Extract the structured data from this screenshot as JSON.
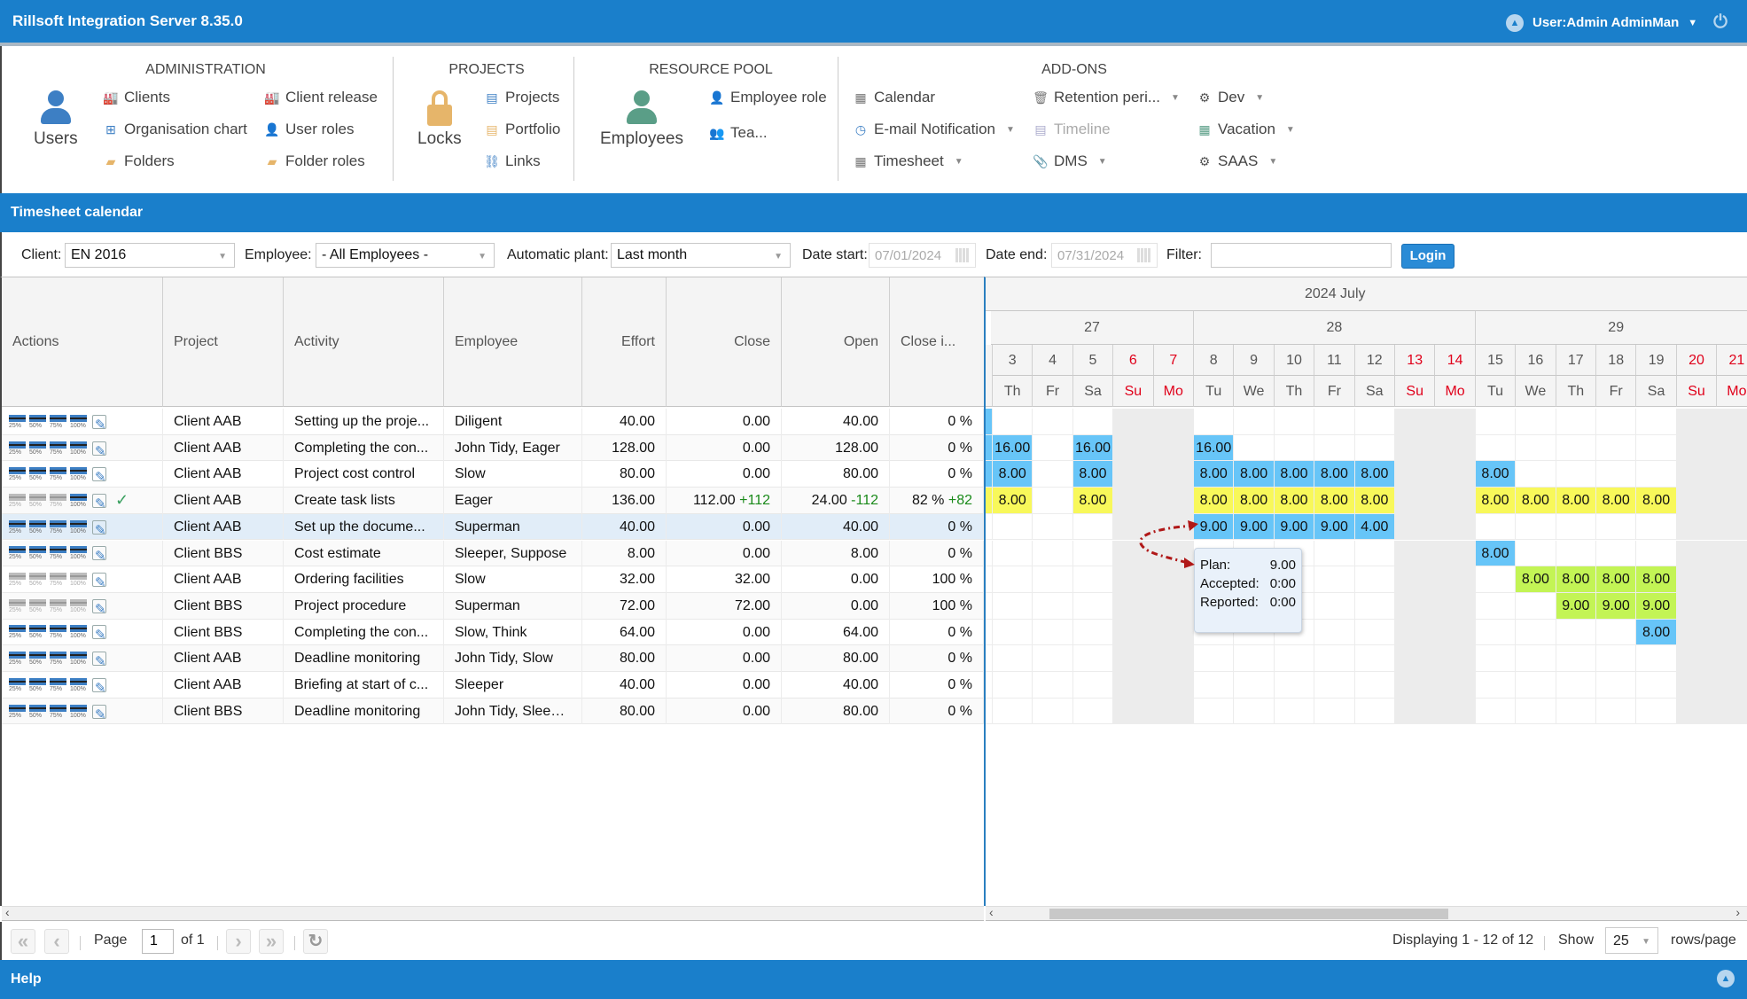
{
  "header": {
    "app_title": "Rillsoft Integration Server 8.35.0",
    "user_label": "User:Admin AdminMan"
  },
  "ribbon": {
    "groups": {
      "administration": "ADMINISTRATION",
      "projects": "PROJECTS",
      "resource_pool": "RESOURCE POOL",
      "addons": "ADD-ONS"
    },
    "users": "Users",
    "clients": "Clients",
    "org_chart": "Organisation chart",
    "folders": "Folders",
    "client_release": "Client release",
    "user_roles": "User roles",
    "folder_roles": "Folder roles",
    "locks": "Locks",
    "projects": "Projects",
    "portfolio": "Portfolio",
    "links": "Links",
    "employees": "Employees",
    "employee_role": "Employee role",
    "teams": "Tea...",
    "calendar": "Calendar",
    "email_notification": "E-mail Notification",
    "timesheet": "Timesheet",
    "retention": "Retention peri...",
    "timeline": "Timeline",
    "dms": "DMS",
    "dev": "Dev",
    "vacation": "Vacation",
    "saas": "SAAS"
  },
  "section_title": "Timesheet calendar",
  "filters": {
    "client_label": "Client:",
    "client_value": "EN 2016",
    "employee_label": "Employee:",
    "employee_value": "- All Employees -",
    "plant_label": "Automatic plant:",
    "plant_value": "Last month",
    "date_start_label": "Date start:",
    "date_start_value": "07/01/2024",
    "date_end_label": "Date end:",
    "date_end_value": "07/31/2024",
    "filter_label": "Filter:",
    "filter_value": "",
    "login_button": "Login"
  },
  "table": {
    "columns": [
      "Actions",
      "Project",
      "Activity",
      "Employee",
      "Effort",
      "Close",
      "Open",
      "Close i..."
    ],
    "rows": [
      {
        "project": "Client AAB",
        "activity": "Setting up the proje...",
        "employee": "Diligent",
        "effort": "40.00",
        "close": "0.00",
        "close_delta": "",
        "open": "40.00",
        "open_delta": "",
        "close_pct": "0 %",
        "pct_delta": "",
        "grey": [
          false,
          false,
          false,
          false
        ],
        "check": false
      },
      {
        "project": "Client AAB",
        "activity": "Completing the con...",
        "employee": "John Tidy, Eager",
        "effort": "128.00",
        "close": "0.00",
        "close_delta": "",
        "open": "128.00",
        "open_delta": "",
        "close_pct": "0 %",
        "pct_delta": "",
        "grey": [
          false,
          false,
          false,
          false
        ],
        "check": false
      },
      {
        "project": "Client AAB",
        "activity": "Project cost control",
        "employee": "Slow",
        "effort": "80.00",
        "close": "0.00",
        "close_delta": "",
        "open": "80.00",
        "open_delta": "",
        "close_pct": "0 %",
        "pct_delta": "",
        "grey": [
          false,
          false,
          false,
          false
        ],
        "check": false
      },
      {
        "project": "Client AAB",
        "activity": "Create task lists",
        "employee": "Eager",
        "effort": "136.00",
        "close": "112.00",
        "close_delta": "+112",
        "open": "24.00",
        "open_delta": "-112",
        "close_pct": "82 %",
        "pct_delta": "+82",
        "grey": [
          true,
          true,
          true,
          false
        ],
        "check": true
      },
      {
        "project": "Client AAB",
        "activity": "Set up the docume...",
        "employee": "Superman",
        "effort": "40.00",
        "close": "0.00",
        "close_delta": "",
        "open": "40.00",
        "open_delta": "",
        "close_pct": "0 %",
        "pct_delta": "",
        "grey": [
          false,
          false,
          false,
          false
        ],
        "check": false,
        "selected": true
      },
      {
        "project": "Client BBS",
        "activity": "Cost estimate",
        "employee": "Sleeper, Suppose",
        "effort": "8.00",
        "close": "0.00",
        "close_delta": "",
        "open": "8.00",
        "open_delta": "",
        "close_pct": "0 %",
        "pct_delta": "",
        "grey": [
          false,
          false,
          false,
          false
        ],
        "check": false
      },
      {
        "project": "Client AAB",
        "activity": "Ordering facilities",
        "employee": "Slow",
        "effort": "32.00",
        "close": "32.00",
        "close_delta": "",
        "open": "0.00",
        "open_delta": "",
        "close_pct": "100 %",
        "pct_delta": "",
        "grey": [
          true,
          true,
          true,
          true
        ],
        "check": false
      },
      {
        "project": "Client BBS",
        "activity": "Project procedure",
        "employee": "Superman",
        "effort": "72.00",
        "close": "72.00",
        "close_delta": "",
        "open": "0.00",
        "open_delta": "",
        "close_pct": "100 %",
        "pct_delta": "",
        "grey": [
          true,
          true,
          true,
          true
        ],
        "check": false
      },
      {
        "project": "Client BBS",
        "activity": "Completing the con...",
        "employee": "Slow, Think",
        "effort": "64.00",
        "close": "0.00",
        "close_delta": "",
        "open": "64.00",
        "open_delta": "",
        "close_pct": "0 %",
        "pct_delta": "",
        "grey": [
          false,
          false,
          false,
          false
        ],
        "check": false
      },
      {
        "project": "Client AAB",
        "activity": "Deadline monitoring",
        "employee": "John Tidy, Slow",
        "effort": "80.00",
        "close": "0.00",
        "close_delta": "",
        "open": "80.00",
        "open_delta": "",
        "close_pct": "0 %",
        "pct_delta": "",
        "grey": [
          false,
          false,
          false,
          false
        ],
        "check": false
      },
      {
        "project": "Client AAB",
        "activity": "Briefing at start of c...",
        "employee": "Sleeper",
        "effort": "40.00",
        "close": "0.00",
        "close_delta": "",
        "open": "40.00",
        "open_delta": "",
        "close_pct": "0 %",
        "pct_delta": "",
        "grey": [
          false,
          false,
          false,
          false
        ],
        "check": false
      },
      {
        "project": "Client BBS",
        "activity": "Deadline monitoring",
        "employee": "John Tidy, Sleeper",
        "effort": "80.00",
        "close": "0.00",
        "close_delta": "",
        "open": "80.00",
        "open_delta": "",
        "close_pct": "0 %",
        "pct_delta": "",
        "grey": [
          false,
          false,
          false,
          false
        ],
        "check": false
      }
    ],
    "pct_labels": [
      "25%",
      "50%",
      "75%",
      "100%"
    ]
  },
  "calendar": {
    "month": "2024 July",
    "weeks": [
      {
        "label": "27",
        "days": 5
      },
      {
        "label": "28",
        "days": 7
      },
      {
        "label": "29",
        "days": 7
      }
    ],
    "days": [
      {
        "num": "3",
        "wd": "Th",
        "weekend": false
      },
      {
        "num": "4",
        "wd": "Fr",
        "weekend": false
      },
      {
        "num": "5",
        "wd": "Sa",
        "weekend": false
      },
      {
        "num": "6",
        "wd": "Su",
        "weekend": true
      },
      {
        "num": "7",
        "wd": "Mo",
        "weekend": true
      },
      {
        "num": "8",
        "wd": "Tu",
        "weekend": false
      },
      {
        "num": "9",
        "wd": "We",
        "weekend": false
      },
      {
        "num": "10",
        "wd": "Th",
        "weekend": false
      },
      {
        "num": "11",
        "wd": "Fr",
        "weekend": false
      },
      {
        "num": "12",
        "wd": "Sa",
        "weekend": false
      },
      {
        "num": "13",
        "wd": "Su",
        "weekend": true
      },
      {
        "num": "14",
        "wd": "Mo",
        "weekend": true
      },
      {
        "num": "15",
        "wd": "Tu",
        "weekend": false
      },
      {
        "num": "16",
        "wd": "We",
        "weekend": false
      },
      {
        "num": "17",
        "wd": "Th",
        "weekend": false
      },
      {
        "num": "18",
        "wd": "Fr",
        "weekend": false
      },
      {
        "num": "19",
        "wd": "Sa",
        "weekend": false
      },
      {
        "num": "20",
        "wd": "Su",
        "weekend": true
      },
      {
        "num": "21",
        "wd": "Mo",
        "weekend": true
      }
    ],
    "entries": [
      {
        "row": 1,
        "day": "3",
        "value": "16.00",
        "color": "blue"
      },
      {
        "row": 1,
        "day": "5",
        "value": "16.00",
        "color": "blue"
      },
      {
        "row": 1,
        "day": "8",
        "value": "16.00",
        "color": "blue"
      },
      {
        "row": 2,
        "day": "3",
        "value": "8.00",
        "color": "blue"
      },
      {
        "row": 2,
        "day": "5",
        "value": "8.00",
        "color": "blue"
      },
      {
        "row": 2,
        "day": "8",
        "value": "8.00",
        "color": "blue"
      },
      {
        "row": 2,
        "day": "9",
        "value": "8.00",
        "color": "blue"
      },
      {
        "row": 2,
        "day": "10",
        "value": "8.00",
        "color": "blue"
      },
      {
        "row": 2,
        "day": "11",
        "value": "8.00",
        "color": "blue"
      },
      {
        "row": 2,
        "day": "12",
        "value": "8.00",
        "color": "blue"
      },
      {
        "row": 2,
        "day": "15",
        "value": "8.00",
        "color": "blue"
      },
      {
        "row": 3,
        "day": "3",
        "value": "8.00",
        "color": "yellow"
      },
      {
        "row": 3,
        "day": "5",
        "value": "8.00",
        "color": "yellow"
      },
      {
        "row": 3,
        "day": "8",
        "value": "8.00",
        "color": "yellow"
      },
      {
        "row": 3,
        "day": "9",
        "value": "8.00",
        "color": "yellow"
      },
      {
        "row": 3,
        "day": "10",
        "value": "8.00",
        "color": "yellow"
      },
      {
        "row": 3,
        "day": "11",
        "value": "8.00",
        "color": "yellow"
      },
      {
        "row": 3,
        "day": "12",
        "value": "8.00",
        "color": "yellow"
      },
      {
        "row": 3,
        "day": "15",
        "value": "8.00",
        "color": "yellow"
      },
      {
        "row": 3,
        "day": "16",
        "value": "8.00",
        "color": "yellow"
      },
      {
        "row": 3,
        "day": "17",
        "value": "8.00",
        "color": "yellow"
      },
      {
        "row": 3,
        "day": "18",
        "value": "8.00",
        "color": "yellow"
      },
      {
        "row": 3,
        "day": "19",
        "value": "8.00",
        "color": "yellow"
      },
      {
        "row": 4,
        "day": "8",
        "value": "9.00",
        "color": "blue"
      },
      {
        "row": 4,
        "day": "9",
        "value": "9.00",
        "color": "blue"
      },
      {
        "row": 4,
        "day": "10",
        "value": "9.00",
        "color": "blue"
      },
      {
        "row": 4,
        "day": "11",
        "value": "9.00",
        "color": "blue"
      },
      {
        "row": 4,
        "day": "12",
        "value": "4.00",
        "color": "blue"
      },
      {
        "row": 5,
        "day": "15",
        "value": "8.00",
        "color": "blue"
      },
      {
        "row": 6,
        "day": "16",
        "value": "8.00",
        "color": "green"
      },
      {
        "row": 6,
        "day": "17",
        "value": "8.00",
        "color": "green"
      },
      {
        "row": 6,
        "day": "18",
        "value": "8.00",
        "color": "green"
      },
      {
        "row": 6,
        "day": "19",
        "value": "8.00",
        "color": "green"
      },
      {
        "row": 7,
        "day": "17",
        "value": "9.00",
        "color": "green"
      },
      {
        "row": 7,
        "day": "18",
        "value": "9.00",
        "color": "green"
      },
      {
        "row": 7,
        "day": "19",
        "value": "9.00",
        "color": "green"
      },
      {
        "row": 8,
        "day": "19",
        "value": "8.00",
        "color": "blue"
      }
    ],
    "colors": {
      "blue": "#67c5f8",
      "yellow": "#f8f85a",
      "green": "#c3f455"
    }
  },
  "tooltip": {
    "plan_label": "Plan:",
    "plan_value": "9.00",
    "accepted_label": "Accepted:",
    "accepted_value": "0:00",
    "reported_label": "Reported:",
    "reported_value": "0:00"
  },
  "pager": {
    "page_label": "Page",
    "page_value": "1",
    "of_label": "of 1",
    "displaying": "Displaying 1 - 12 of 12",
    "show_label": "Show",
    "rows_value": "25",
    "rows_label": "rows/page"
  },
  "footer": {
    "help": "Help"
  }
}
